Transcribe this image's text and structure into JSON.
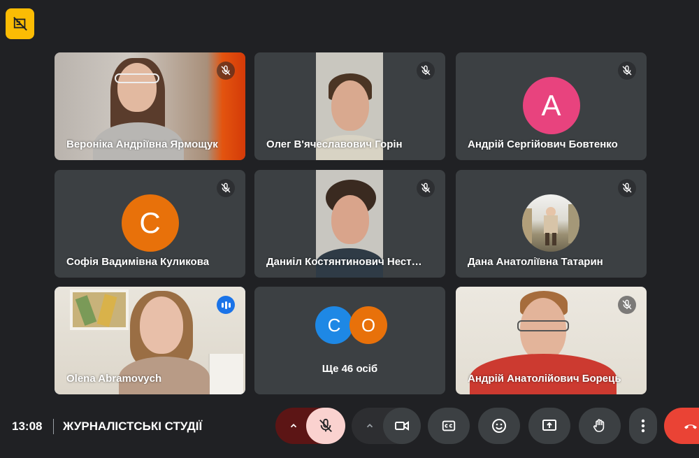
{
  "participants": [
    {
      "name": "Вероніка Андріївна Ярмощук"
    },
    {
      "name": "Олег В'ячеславович Горін"
    },
    {
      "name": "Андрій Сергійович Бовтенко",
      "initial": "A"
    },
    {
      "name": "Софія Вадимівна Куликова",
      "initial": "C"
    },
    {
      "name": "Даниіл Костянтинович Нест…"
    },
    {
      "name": "Дана Анатоліївна Татарин"
    },
    {
      "name": "Olena Abramovych"
    },
    {
      "name": "Андрій Анатолійович Борець"
    }
  ],
  "others": {
    "label": "Ще 46 осіб",
    "initials": [
      "C",
      "O"
    ]
  },
  "footer": {
    "time": "13:08",
    "meeting_title": "ЖУРНАЛІСТСЬКІ СТУДІЇ"
  },
  "colors": {
    "background": "#202124",
    "tile": "#3c4043",
    "accent_yellow": "#fbbc04",
    "avatar_pink": "#e8437e",
    "avatar_orange": "#e8710a",
    "avatar_blue": "#1e88e5",
    "end_call": "#ea4335",
    "speaking": "#8ab4f8"
  },
  "icons": [
    "no-recording-icon",
    "mic-off-icon",
    "speaking-icon",
    "chevron-up-icon",
    "camera-icon",
    "captions-icon",
    "emoji-icon",
    "present-icon",
    "raise-hand-icon",
    "more-icon",
    "end-call-icon"
  ]
}
